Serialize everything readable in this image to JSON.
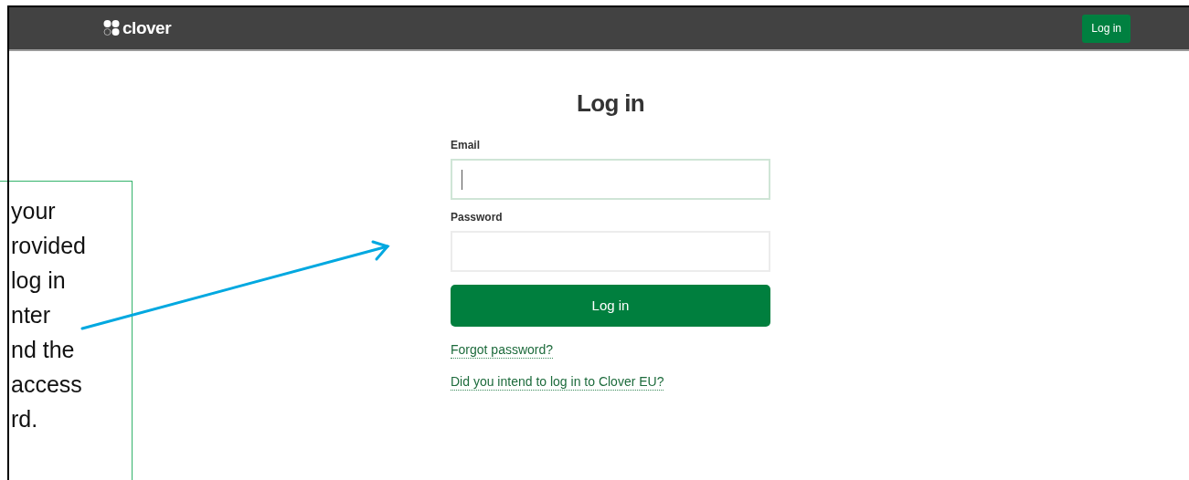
{
  "header": {
    "logo_text": "clover",
    "button": "Log in"
  },
  "form": {
    "title": "Log in",
    "fields": [
      {
        "label": "Email",
        "focused": true
      },
      {
        "label": "Password",
        "focused": false
      }
    ],
    "submit": "Log in",
    "links": [
      "Forgot password?",
      "Did you intend to log in to Clover EU?"
    ]
  },
  "callout": {
    "lines": [
      "your",
      "rovided",
      "log in",
      "nter",
      "nd the",
      "access",
      "rd."
    ]
  }
}
